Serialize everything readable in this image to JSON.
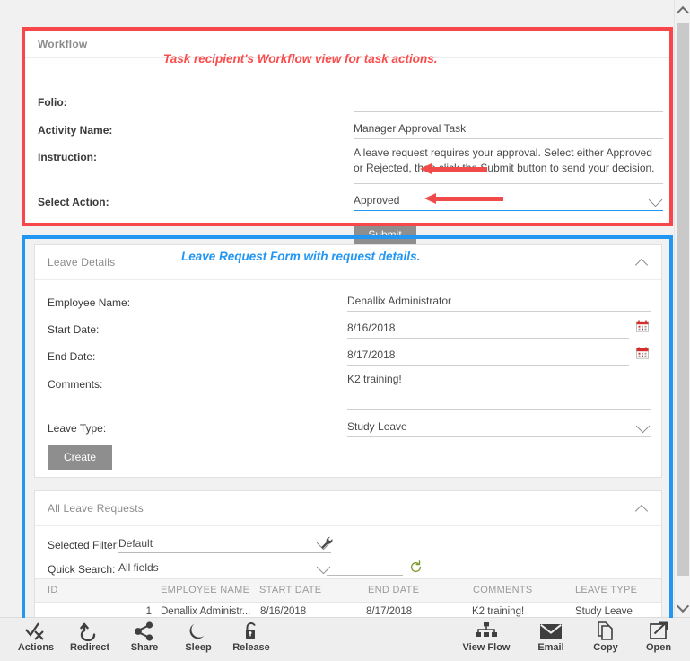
{
  "workflow": {
    "panel_title": "Workflow",
    "annotation": "Task recipient's Workflow view for task actions.",
    "fields": [
      {
        "label": "Folio:",
        "value": ""
      },
      {
        "label": "Activity Name:",
        "value": "Manager Approval Task"
      },
      {
        "label": "Instruction:",
        "value": "A leave request requires your approval. Select either Approved or Rejected, then click the Submit button to send your decision."
      },
      {
        "label": "Select Action:",
        "value": "Approved"
      }
    ],
    "submit_label": "Submit"
  },
  "leave_details": {
    "panel_title": "Leave Details",
    "annotation": "Leave Request Form with request details.",
    "fields": [
      {
        "label": "Employee Name:",
        "value": "Denallix Administrator"
      },
      {
        "label": "Start Date:",
        "value": "8/16/2018"
      },
      {
        "label": "End Date:",
        "value": "8/17/2018"
      },
      {
        "label": "Comments:",
        "value": "K2 training!"
      },
      {
        "label": "Leave Type:",
        "value": "Study Leave"
      }
    ],
    "create_label": "Create"
  },
  "all_leave_requests": {
    "panel_title": "All Leave Requests",
    "selected_filter_label": "Selected Filter:",
    "selected_filter_value": "Default",
    "quick_search_label": "Quick Search:",
    "quick_search_value": "All fields",
    "quick_search_text": "",
    "columns": [
      "ID",
      "EMPLOYEE NAME",
      "START DATE",
      "END DATE",
      "COMMENTS",
      "LEAVE TYPE"
    ],
    "rows": [
      {
        "id": "1",
        "employee_name": "Denallix Administr...",
        "start_date": "8/16/2018",
        "end_date": "8/17/2018",
        "comments": "K2 training!",
        "leave_type": "Study Leave"
      }
    ]
  },
  "toolbar": {
    "items": [
      {
        "label": "Actions",
        "icon": "check-x-icon"
      },
      {
        "label": "Redirect",
        "icon": "undo-arrow-icon"
      },
      {
        "label": "Share",
        "icon": "share-nodes-icon"
      },
      {
        "label": "Sleep",
        "icon": "moon-icon"
      },
      {
        "label": "Release",
        "icon": "unlock-icon"
      },
      {
        "label": "View Flow",
        "icon": "org-chart-icon"
      },
      {
        "label": "Email",
        "icon": "envelope-icon"
      },
      {
        "label": "Copy",
        "icon": "copy-pages-icon"
      },
      {
        "label": "Open",
        "icon": "open-external-icon"
      }
    ]
  },
  "colors": {
    "annotation_red": "#f7474b",
    "annotation_blue": "#2196f3",
    "button_grey": "#8e8e8e",
    "focus_underline": "#2196f3",
    "calendar_icon": "#d32f2f",
    "refresh_icon": "#7f9c32"
  }
}
